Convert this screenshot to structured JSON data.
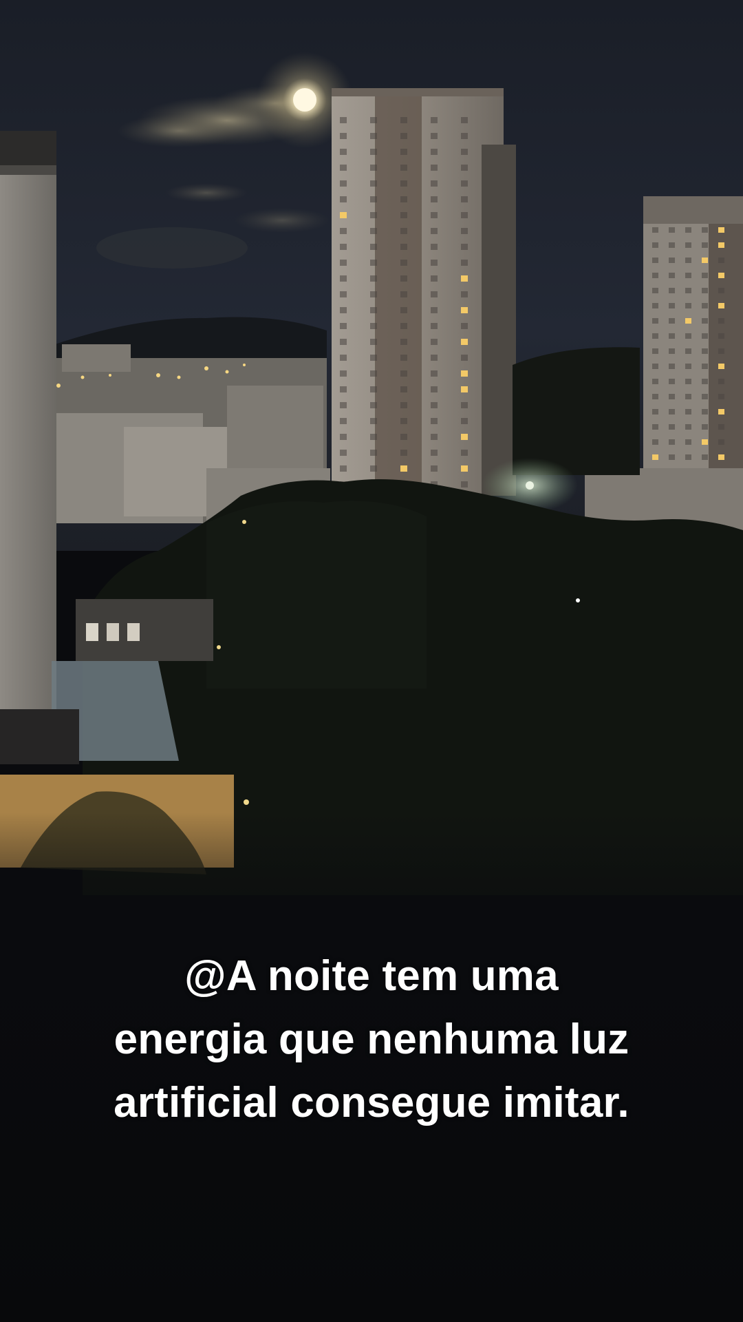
{
  "caption": {
    "lines": [
      "@A noite tem uma",
      "energia que nenhuma luz",
      "artificial consegue imitar."
    ]
  },
  "scene": {
    "description_icon": "night-city-moon-photo",
    "sky_color": "#1b2029",
    "foliage_color": "#101410",
    "moon_color": "#fff6dc",
    "window_light_color": "#f3c967"
  }
}
